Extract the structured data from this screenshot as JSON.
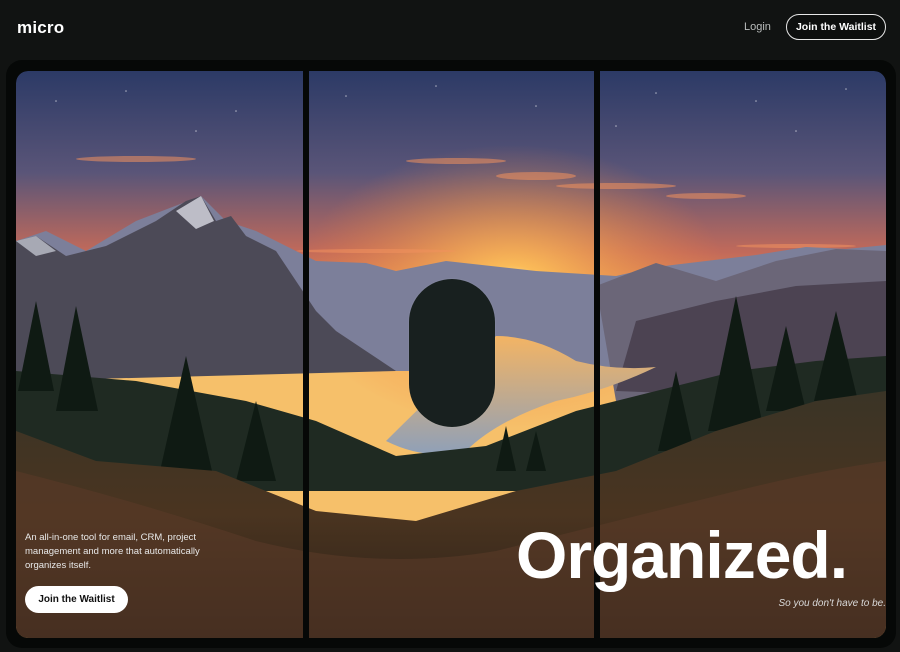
{
  "header": {
    "logo": "micro",
    "login_label": "Login",
    "cta_label": "Join the Waitlist"
  },
  "hero": {
    "tagline": "An all-in-one tool for email, CRM, project management and more that automatically organizes itself.",
    "cta_label": "Join the Waitlist",
    "headline": "Organized.",
    "subheadline": "So you don't have to be."
  },
  "colors": {
    "background": "#111312",
    "frame": "#060807",
    "button_light": "#ffffff",
    "pill": "#18201f"
  },
  "icons": [
    "mountain-landscape-image"
  ]
}
